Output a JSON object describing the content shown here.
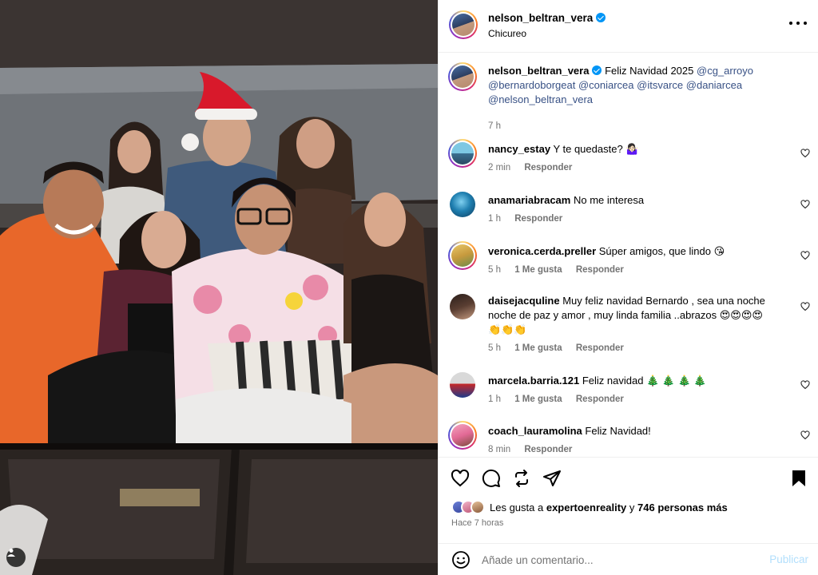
{
  "header": {
    "username": "nelson_beltran_vera",
    "location": "Chicureo"
  },
  "caption": {
    "username": "nelson_beltran_vera",
    "text": "Feliz Navidad 2025",
    "mentions": [
      "@cg_arroyo",
      "@bernardoborgeat",
      "@coniarcea",
      "@itsvarce",
      "@daniarcea",
      "@nelson_beltran_vera"
    ],
    "time": "7 h"
  },
  "comments": [
    {
      "username": "nancy_estay",
      "text": "Y te quedaste? 🤷🏻‍♀️",
      "time": "2 min",
      "likes": "",
      "reply": "Responder"
    },
    {
      "username": "anamariabracam",
      "text": "No me interesa",
      "time": "1 h",
      "likes": "",
      "reply": "Responder"
    },
    {
      "username": "veronica.cerda.preller",
      "text": "Súper amigos, que lindo 😘",
      "time": "5 h",
      "likes": "1 Me gusta",
      "reply": "Responder"
    },
    {
      "username": "daisejacquline",
      "text": "Muy feliz navidad Bernardo , sea una noche noche de paz y amor , muy linda familia ..abrazos 😍😍😍😍 👏👏👏",
      "time": "5 h",
      "likes": "1 Me gusta",
      "reply": "Responder"
    },
    {
      "username": "marcela.barria.121",
      "text": "Feliz navidad 🎄 🎄 🎄 🎄",
      "time": "1 h",
      "likes": "1 Me gusta",
      "reply": "Responder"
    },
    {
      "username": "coach_lauramolina",
      "text": "Feliz Navidad!",
      "time": "8 min",
      "likes": "",
      "reply": "Responder"
    }
  ],
  "likes": {
    "prefix": "Les gusta a",
    "user": "expertoenreality",
    "connector": "y",
    "others": "746 personas más"
  },
  "posted": "Hace 7 horas",
  "add_comment": {
    "placeholder": "Añade un comentario...",
    "post_label": "Publicar"
  },
  "icons": {
    "more": "more-horizontal-icon",
    "like": "heart-icon",
    "comment": "comment-icon",
    "share": "repost-icon",
    "send": "send-icon",
    "save": "bookmark-icon",
    "emoji": "emoji-icon",
    "tag": "user-tag-icon"
  },
  "colors": {
    "accent": "#0095f6",
    "mention": "#385185",
    "muted": "#737373",
    "post_disabled": "#b2dffc"
  }
}
